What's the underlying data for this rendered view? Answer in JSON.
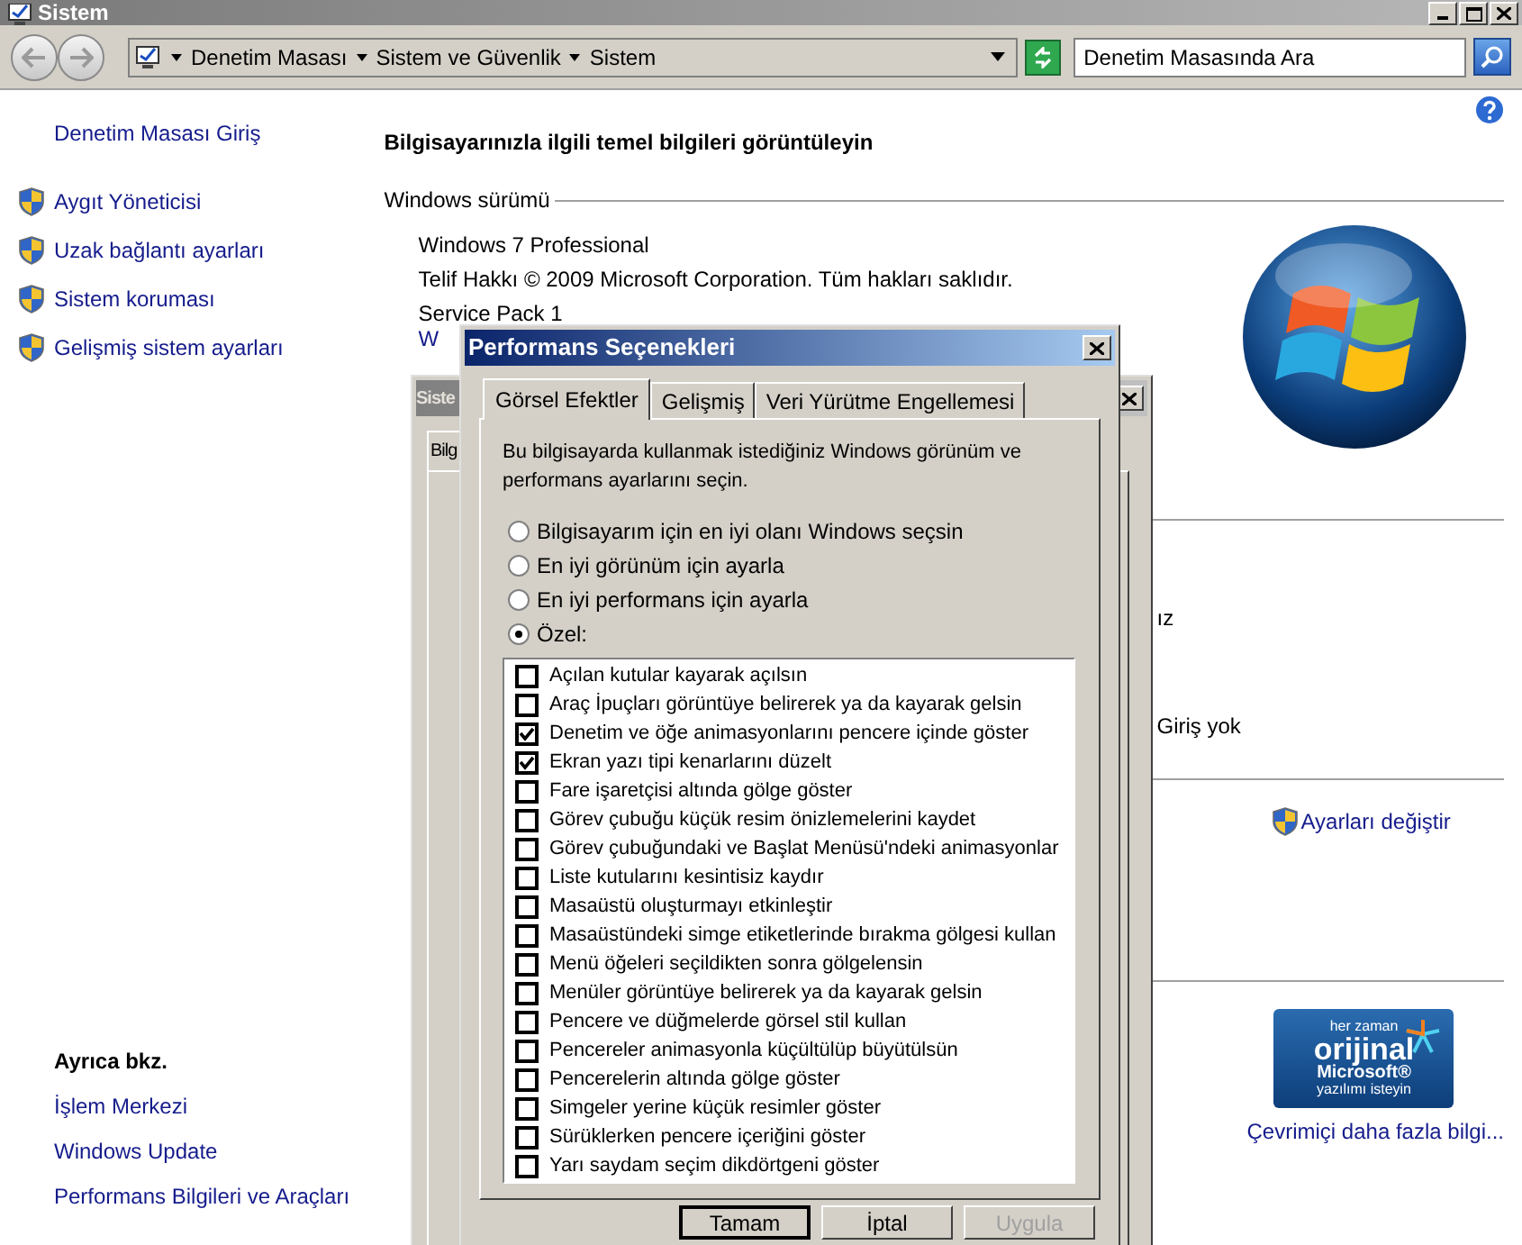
{
  "window": {
    "title": "Sistem"
  },
  "address_bar": {
    "breadcrumbs": [
      "Denetim Masası",
      "Sistem ve Güvenlik",
      "Sistem"
    ]
  },
  "search": {
    "placeholder": "Denetim Masasında Ara"
  },
  "sidebar": {
    "home_link": "Denetim Masası Giriş",
    "items": [
      "Aygıt Yöneticisi",
      "Uzak bağlantı ayarları",
      "Sistem koruması",
      "Gelişmiş sistem ayarları"
    ],
    "see_also": {
      "title": "Ayrıca bkz.",
      "links": [
        "İşlem Merkezi",
        "Windows Update",
        "Performans Bilgileri ve Araçları"
      ]
    }
  },
  "main": {
    "heading": "Bilgisayarınızla ilgili temel bilgileri görüntüleyin",
    "edition": {
      "title": "Windows sürümü",
      "lines": [
        "Windows 7 Professional",
        "Telif Hakkı © 2009 Microsoft Corporation. Tüm hakları saklıdır.",
        "Service Pack 1"
      ],
      "link": "W"
    },
    "partial_texts": [
      "ız",
      "Giriş yok"
    ],
    "change_settings": "Ayarları değiştir",
    "genuine_badge": {
      "lines": [
        "her zaman",
        "orijinal",
        "Microsoft®",
        "yazılımı isteyin"
      ]
    },
    "more_info_link": "Çevrimiçi daha fazla bilgi..."
  },
  "background_dialog": {
    "title": "Siste",
    "tab": "Bilg"
  },
  "dialog": {
    "title": "Performans Seçenekleri",
    "tabs": [
      {
        "label": "Görsel Efektler",
        "selected": true
      },
      {
        "label": "Gelişmiş",
        "selected": false
      },
      {
        "label": "Veri Yürütme Engellemesi",
        "selected": false
      }
    ],
    "description": "Bu bilgisayarda kullanmak istediğiniz Windows görünüm ve performans ayarlarını seçin.",
    "radios": [
      {
        "label": "Bilgisayarım için en iyi olanı Windows seçsin",
        "selected": false
      },
      {
        "label": "En iyi görünüm için ayarla",
        "selected": false
      },
      {
        "label": "En iyi performans için ayarla",
        "selected": false
      },
      {
        "label": "Özel:",
        "selected": true
      }
    ],
    "effects": [
      {
        "label": "Açılan kutular kayarak açılsın",
        "checked": false
      },
      {
        "label": "Araç İpuçları görüntüye belirerek ya da kayarak gelsin",
        "checked": false
      },
      {
        "label": "Denetim ve öğe animasyonlarını pencere içinde göster",
        "checked": true
      },
      {
        "label": "Ekran yazı tipi kenarlarını düzelt",
        "checked": true
      },
      {
        "label": "Fare işaretçisi altında gölge göster",
        "checked": false
      },
      {
        "label": "Görev çubuğu küçük resim önizlemelerini kaydet",
        "checked": false
      },
      {
        "label": "Görev çubuğundaki ve Başlat Menüsü'ndeki animasyonlar",
        "checked": false
      },
      {
        "label": "Liste kutularını kesintisiz kaydır",
        "checked": false
      },
      {
        "label": "Masaüstü oluşturmayı etkinleştir",
        "checked": false
      },
      {
        "label": "Masaüstündeki simge etiketlerinde bırakma gölgesi kullan",
        "checked": false
      },
      {
        "label": "Menü öğeleri seçildikten sonra gölgelensin",
        "checked": false
      },
      {
        "label": "Menüler görüntüye belirerek ya da kayarak gelsin",
        "checked": false
      },
      {
        "label": "Pencere ve düğmelerde görsel stil kullan",
        "checked": false
      },
      {
        "label": "Pencereler animasyonla küçültülüp büyütülsün",
        "checked": false
      },
      {
        "label": "Pencerelerin altında gölge göster",
        "checked": false
      },
      {
        "label": "Simgeler yerine küçük resimler göster",
        "checked": false
      },
      {
        "label": "Sürüklerken pencere içeriğini göster",
        "checked": false
      },
      {
        "label": "Yarı saydam seçim dikdörtgeni göster",
        "checked": false
      }
    ],
    "buttons": [
      {
        "label": "Tamam",
        "disabled": false
      },
      {
        "label": "İptal",
        "disabled": false
      },
      {
        "label": "Uygula",
        "disabled": true
      }
    ]
  }
}
